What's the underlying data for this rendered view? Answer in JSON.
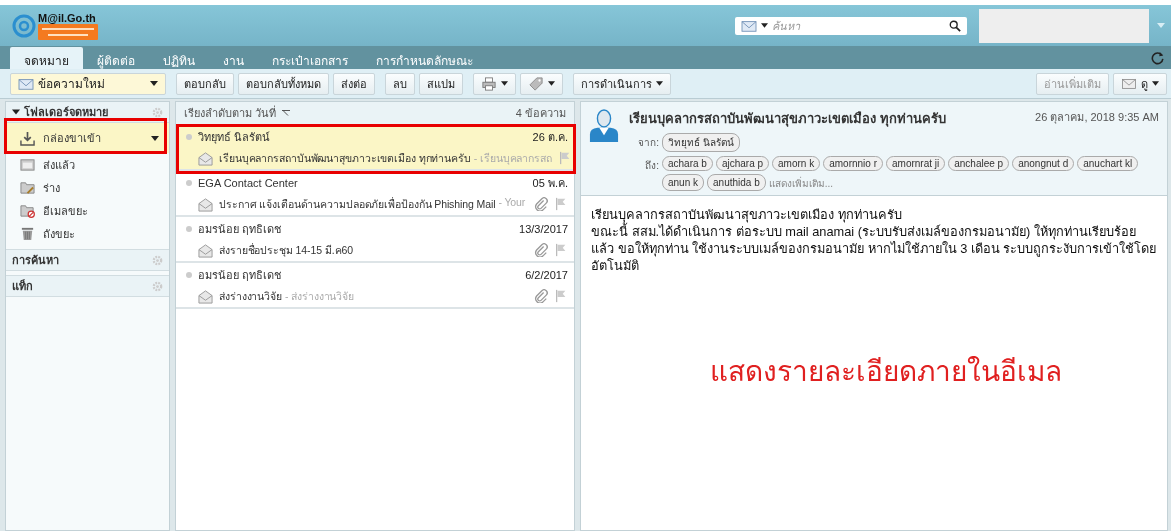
{
  "header": {
    "logo_text": "M@il.Go.th",
    "search_placeholder": "ค้นหา"
  },
  "tabs": [
    {
      "label": "จดหมาย",
      "selected": true
    },
    {
      "label": "ผู้ติดต่อ",
      "selected": false
    },
    {
      "label": "ปฏิทิน",
      "selected": false
    },
    {
      "label": "งาน",
      "selected": false
    },
    {
      "label": "กระเป๋าเอกสาร",
      "selected": false
    },
    {
      "label": "การกำหนดลักษณะ",
      "selected": false
    }
  ],
  "toolbar": {
    "new_message": "ข้อความใหม่",
    "buttons": [
      {
        "kind": "text",
        "label": "ตอบกลับ"
      },
      {
        "kind": "text",
        "label": "ตอบกลับทั้งหมด"
      },
      {
        "kind": "text",
        "label": "ส่งต่อ"
      },
      {
        "kind": "text",
        "label": "ลบ"
      },
      {
        "kind": "text",
        "label": "สแปม"
      },
      {
        "kind": "print"
      },
      {
        "kind": "tag"
      },
      {
        "kind": "menu",
        "label": "การดำเนินการ"
      }
    ],
    "read_more": {
      "label": "อ่านเพิ่มเติม",
      "disabled": true
    },
    "view_menu": "ดู"
  },
  "folders": {
    "header": "โฟลเดอร์จดหมาย",
    "items": [
      {
        "kind": "inbox",
        "label": "กล่องขาเข้า",
        "selected": true
      },
      {
        "kind": "sent",
        "label": "ส่งแล้ว",
        "selected": false
      },
      {
        "kind": "drafts",
        "label": "ร่าง",
        "selected": false
      },
      {
        "kind": "junk",
        "label": "อีเมลขยะ",
        "selected": false
      },
      {
        "kind": "trash",
        "label": "ถังขยะ",
        "selected": false
      }
    ],
    "sections": [
      "การค้นหา",
      "แท็ก"
    ]
  },
  "message_list": {
    "sort_label": "เรียงลำดับตาม วันที่",
    "count": "4 ข้อความ",
    "messages": [
      {
        "sender": "วิทยุทธ์ นิลรัตน์",
        "date": "26 ต.ค.",
        "subject": "เรียนบุคลากรสถาบันพัฒนาสุขภาวะเขตเมือง ทุกท่านครับ",
        "preview": "- เรียนบุคลากรสถ",
        "attachment": false,
        "selected": true
      },
      {
        "sender": "EGA Contact Center",
        "date": "05 พ.ค.",
        "subject": "ประกาศ แจ้งเตือนด้านความปลอดภัยเพื่อป้องกัน Phishing Mail",
        "preview": "- Your",
        "attachment": true,
        "selected": false
      },
      {
        "sender": "อมรน้อย ฤทธิเดช",
        "date": "13/3/2017",
        "subject": "ส่งรายชื่อประชุม 14-15 มี.ค60",
        "attachment": true,
        "selected": false
      },
      {
        "sender": "อมรน้อย ฤทธิเดช",
        "date": "6/2/2017",
        "subject": "ส่งร่างงานวิจัย",
        "preview": "- ส่งร่างงานวิจัย",
        "attachment": true,
        "selected": false
      }
    ]
  },
  "reading_pane": {
    "subject": "เรียนบุคลากรสถาบันพัฒนาสุขภาวะเขตเมือง ทุกท่านครับ",
    "date": "26 ตุลาคม, 2018 9:35 AM",
    "from_label": "จาก:",
    "from": [
      "วิทยุทธ์ นิลรัตน์"
    ],
    "to_label": "ถึง:",
    "to": [
      "achara b",
      "ajchara p",
      "amorn k",
      "amornnio r",
      "amornrat ji",
      "anchalee p",
      "anongnut d",
      "anuchart kl",
      "anun k",
      "anuthida b"
    ],
    "show_more": "แสดงเพิ่มเติม...",
    "body": [
      "เรียนบุคลากรสถาบันพัฒนาสุขภาวะเขตเมือง ทุกท่านครับ",
      "ขณะนี้ สสม.ได้ดำเนินการ ต่อระบบ mail anamai (ระบบรับส่งเมล์ของกรมอนามัย) ให้ทุกท่านเรียบร้อยแล้ว ขอให้ทุกท่าน ใช้งานระบบเมล์ของกรมอนามัย หากไม่ใช้ภายใน 3 เดือน ระบบถูกระงับการเข้าใช้โดยอัตโนมัติ"
    ],
    "annotation": "แสดงรายละเอียดภายในอีเมล"
  }
}
